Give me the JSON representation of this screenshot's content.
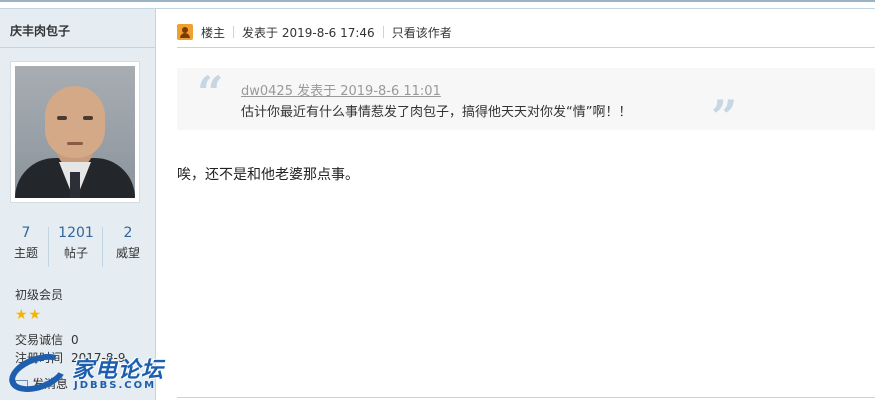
{
  "author": {
    "name": "庆丰肉包子",
    "stats": [
      {
        "num": "7",
        "label": "主题"
      },
      {
        "num": "1201",
        "label": "帖子"
      },
      {
        "num": "2",
        "label": "威望"
      }
    ],
    "group": "初级会员",
    "stars": "★★",
    "credit_label": "交易诚信",
    "credit_value": "0",
    "reg_label": "注册时间",
    "reg_value": "2017-8-9",
    "message_label": "发消息"
  },
  "post": {
    "louzhu": "楼主",
    "posted_at": "发表于 2019-8-6 17:46",
    "only_author": "只看该作者",
    "quote": {
      "meta": "dw0425 发表于 2019-8-6 11:01",
      "text": "估计你最近有什么事情惹发了肉包子，搞得他天天对你发“情”啊！！"
    },
    "content": "唉，还不是和他老婆那点事。"
  },
  "watermark": {
    "title": "家电论坛",
    "subtitle": "JDBBS.COM"
  },
  "colors": {
    "sidebar_bg": "#e5edf2",
    "border": "#c2d5e3",
    "link_blue": "#369",
    "star": "#f5b400",
    "brand": "#1d5fae"
  }
}
